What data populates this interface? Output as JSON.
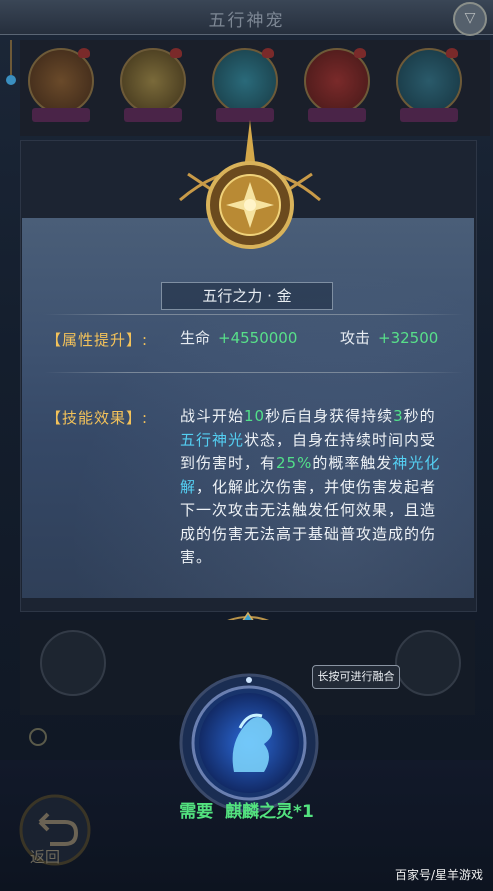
{
  "header": {
    "title": "五行神宠"
  },
  "modal": {
    "subtitle": "五行之力 · 金",
    "attr_label": "【属性提升】:",
    "attrs": [
      {
        "name": "生命",
        "value": "+4550000"
      },
      {
        "name": "攻击",
        "value": "+32500"
      }
    ],
    "skill_label": "【技能效果】:",
    "skill_parts": [
      "战斗开始",
      "10",
      "秒后自身获得持续",
      "3",
      "秒的",
      "五行神光",
      "状态，自身在持续时间内受到伤害时，有",
      "25%",
      "的概率触发",
      "神光化解",
      "，化解此次伤害，并使伤害发起者下一次攻击无法触发任何效果，且造成的伤害无法高于基础普攻造成的伤害。"
    ]
  },
  "tooltip": "长按可进行融合",
  "need": {
    "prefix": "需要",
    "item": "麒麟之灵*1"
  },
  "back_label": "返回",
  "watermark": "百家号/星羊游戏",
  "colors": {
    "accent_gold": "#f3c25a",
    "value_green": "#58e08a",
    "keyword_blue": "#54cff2"
  }
}
